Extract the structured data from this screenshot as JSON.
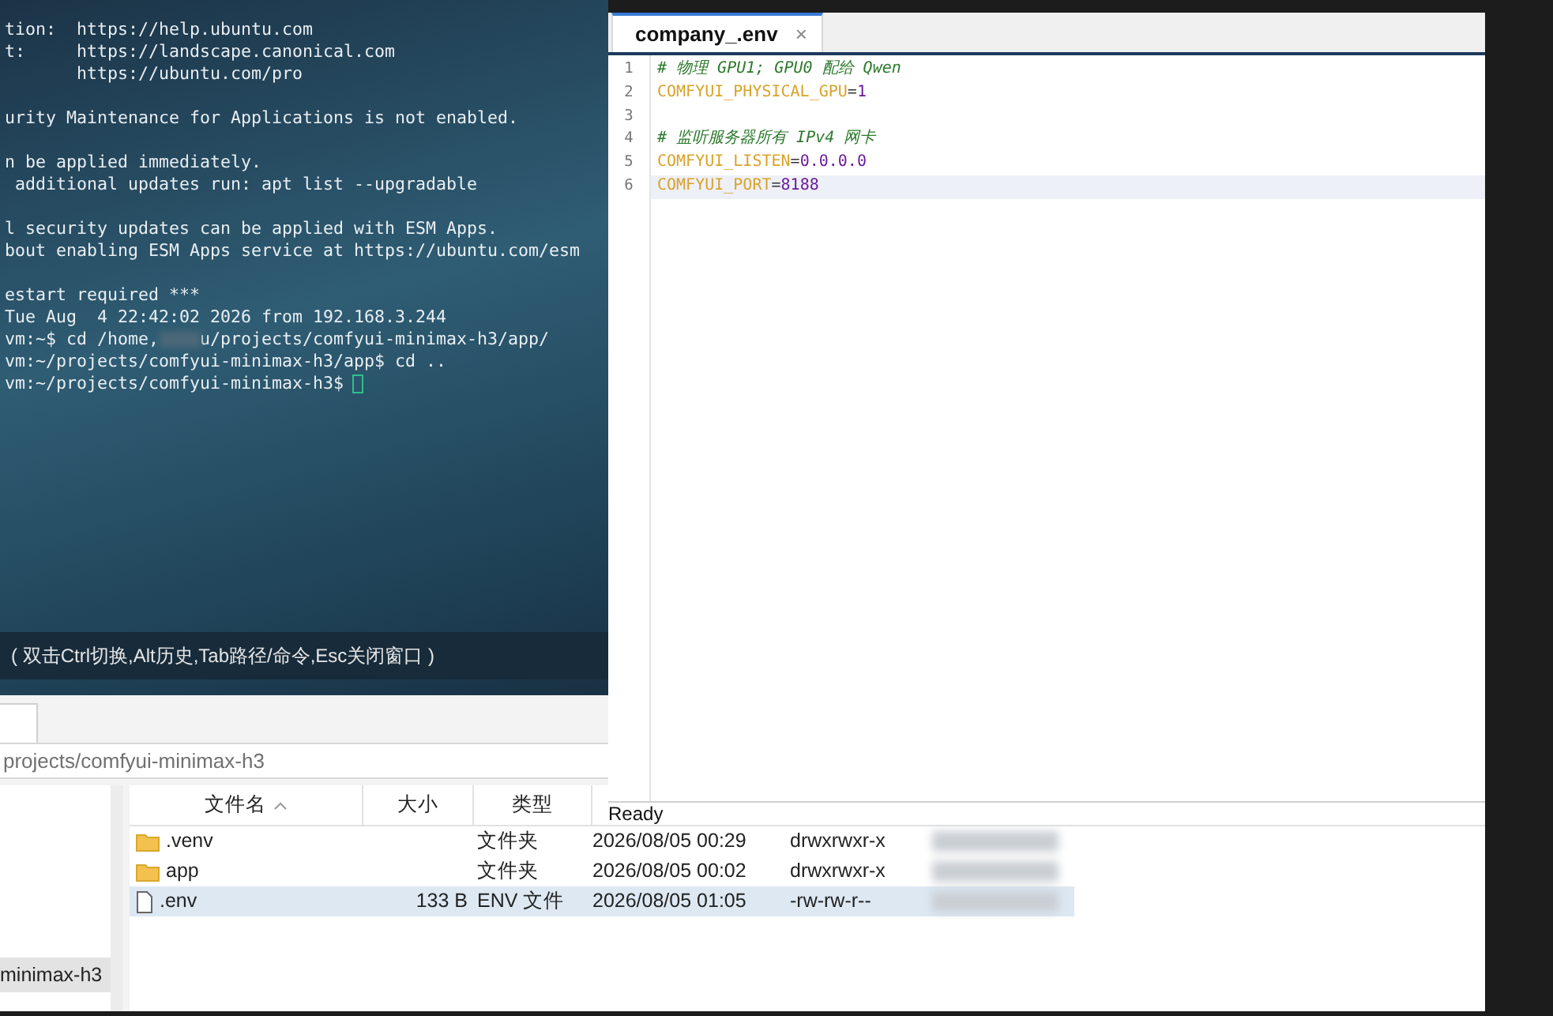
{
  "terminal": {
    "lines": [
      {
        "kind": "text",
        "text": "tion:  https://help.ubuntu.com"
      },
      {
        "kind": "text",
        "text": "t:     https://landscape.canonical.com"
      },
      {
        "kind": "text",
        "text": "       https://ubuntu.com/pro"
      },
      {
        "kind": "blank"
      },
      {
        "kind": "text",
        "text": "urity Maintenance for Applications is not enabled."
      },
      {
        "kind": "blank"
      },
      {
        "kind": "text",
        "text": "n be applied immediately."
      },
      {
        "kind": "text",
        "text": " additional updates run: apt list --upgradable"
      },
      {
        "kind": "blank"
      },
      {
        "kind": "text",
        "text": "l security updates can be applied with ESM Apps."
      },
      {
        "kind": "text",
        "text": "bout enabling ESM Apps service at https://ubuntu.com/esm"
      },
      {
        "kind": "blank"
      },
      {
        "kind": "text",
        "text": "estart required ***"
      },
      {
        "kind": "text",
        "text": "Tue Aug  4 22:42:02 2026 from 192.168.3.244"
      },
      {
        "kind": "redacted",
        "parts": [
          "vm:~$ cd /home,",
          "u/projects/comfyui-minimax-h3/app/"
        ]
      },
      {
        "kind": "text",
        "text": "vm:~/projects/comfyui-minimax-h3/app$ cd .."
      },
      {
        "kind": "prompt",
        "text": "vm:~/projects/comfyui-minimax-h3$",
        "cursor": true
      }
    ],
    "hint": "( 双击Ctrl切换,Alt历史,Tab路径/命令,Esc关闭窗口 )"
  },
  "editor": {
    "tabs": [
      {
        "label": "company_.env",
        "close": "×",
        "selected": true
      }
    ],
    "lines": [
      {
        "number": "1",
        "kind": "comment",
        "text": "# 物理 GPU1; GPU0 配给 Qwen",
        "current": false
      },
      {
        "number": "2",
        "kind": "assign",
        "key": "COMFYUI_PHYSICAL_GPU",
        "op": "=",
        "value": "1",
        "current": false
      },
      {
        "number": "3",
        "kind": "blank",
        "current": false
      },
      {
        "number": "4",
        "kind": "comment",
        "text": "# 监听服务器所有 IPv4 网卡",
        "current": false
      },
      {
        "number": "5",
        "kind": "assign",
        "key": "COMFYUI_LISTEN",
        "op": "=",
        "value": "0.0.0.0",
        "current": false
      },
      {
        "number": "6",
        "kind": "assign",
        "key": "COMFYUI_PORT",
        "op": "=",
        "value": "8188",
        "current": true
      }
    ],
    "status": "Ready"
  },
  "file_manager": {
    "path": "projects/comfyui-minimax-h3",
    "tree": [
      {
        "label": "minimax-h3",
        "selected": true
      }
    ],
    "columns": [
      {
        "label": "文件名",
        "sorted": true
      },
      {
        "label": "大小",
        "sorted": false
      },
      {
        "label": "类型",
        "sorted": false
      }
    ],
    "rows": [
      {
        "kind": "folder",
        "name": ".venv",
        "type": "文件夹",
        "modified": "2026/08/05 00:29",
        "permissions": "drwxrwxr-x",
        "selected": false
      },
      {
        "kind": "folder",
        "name": "app",
        "type": "文件夹",
        "modified": "2026/08/05 00:02",
        "permissions": "drwxrwxr-x",
        "selected": false
      },
      {
        "kind": "file",
        "name": ".env",
        "size": "133 B",
        "type": "ENV 文件",
        "modified": "2026/08/05 01:05",
        "permissions": "-rw-rw-r--",
        "selected": true
      }
    ]
  }
}
